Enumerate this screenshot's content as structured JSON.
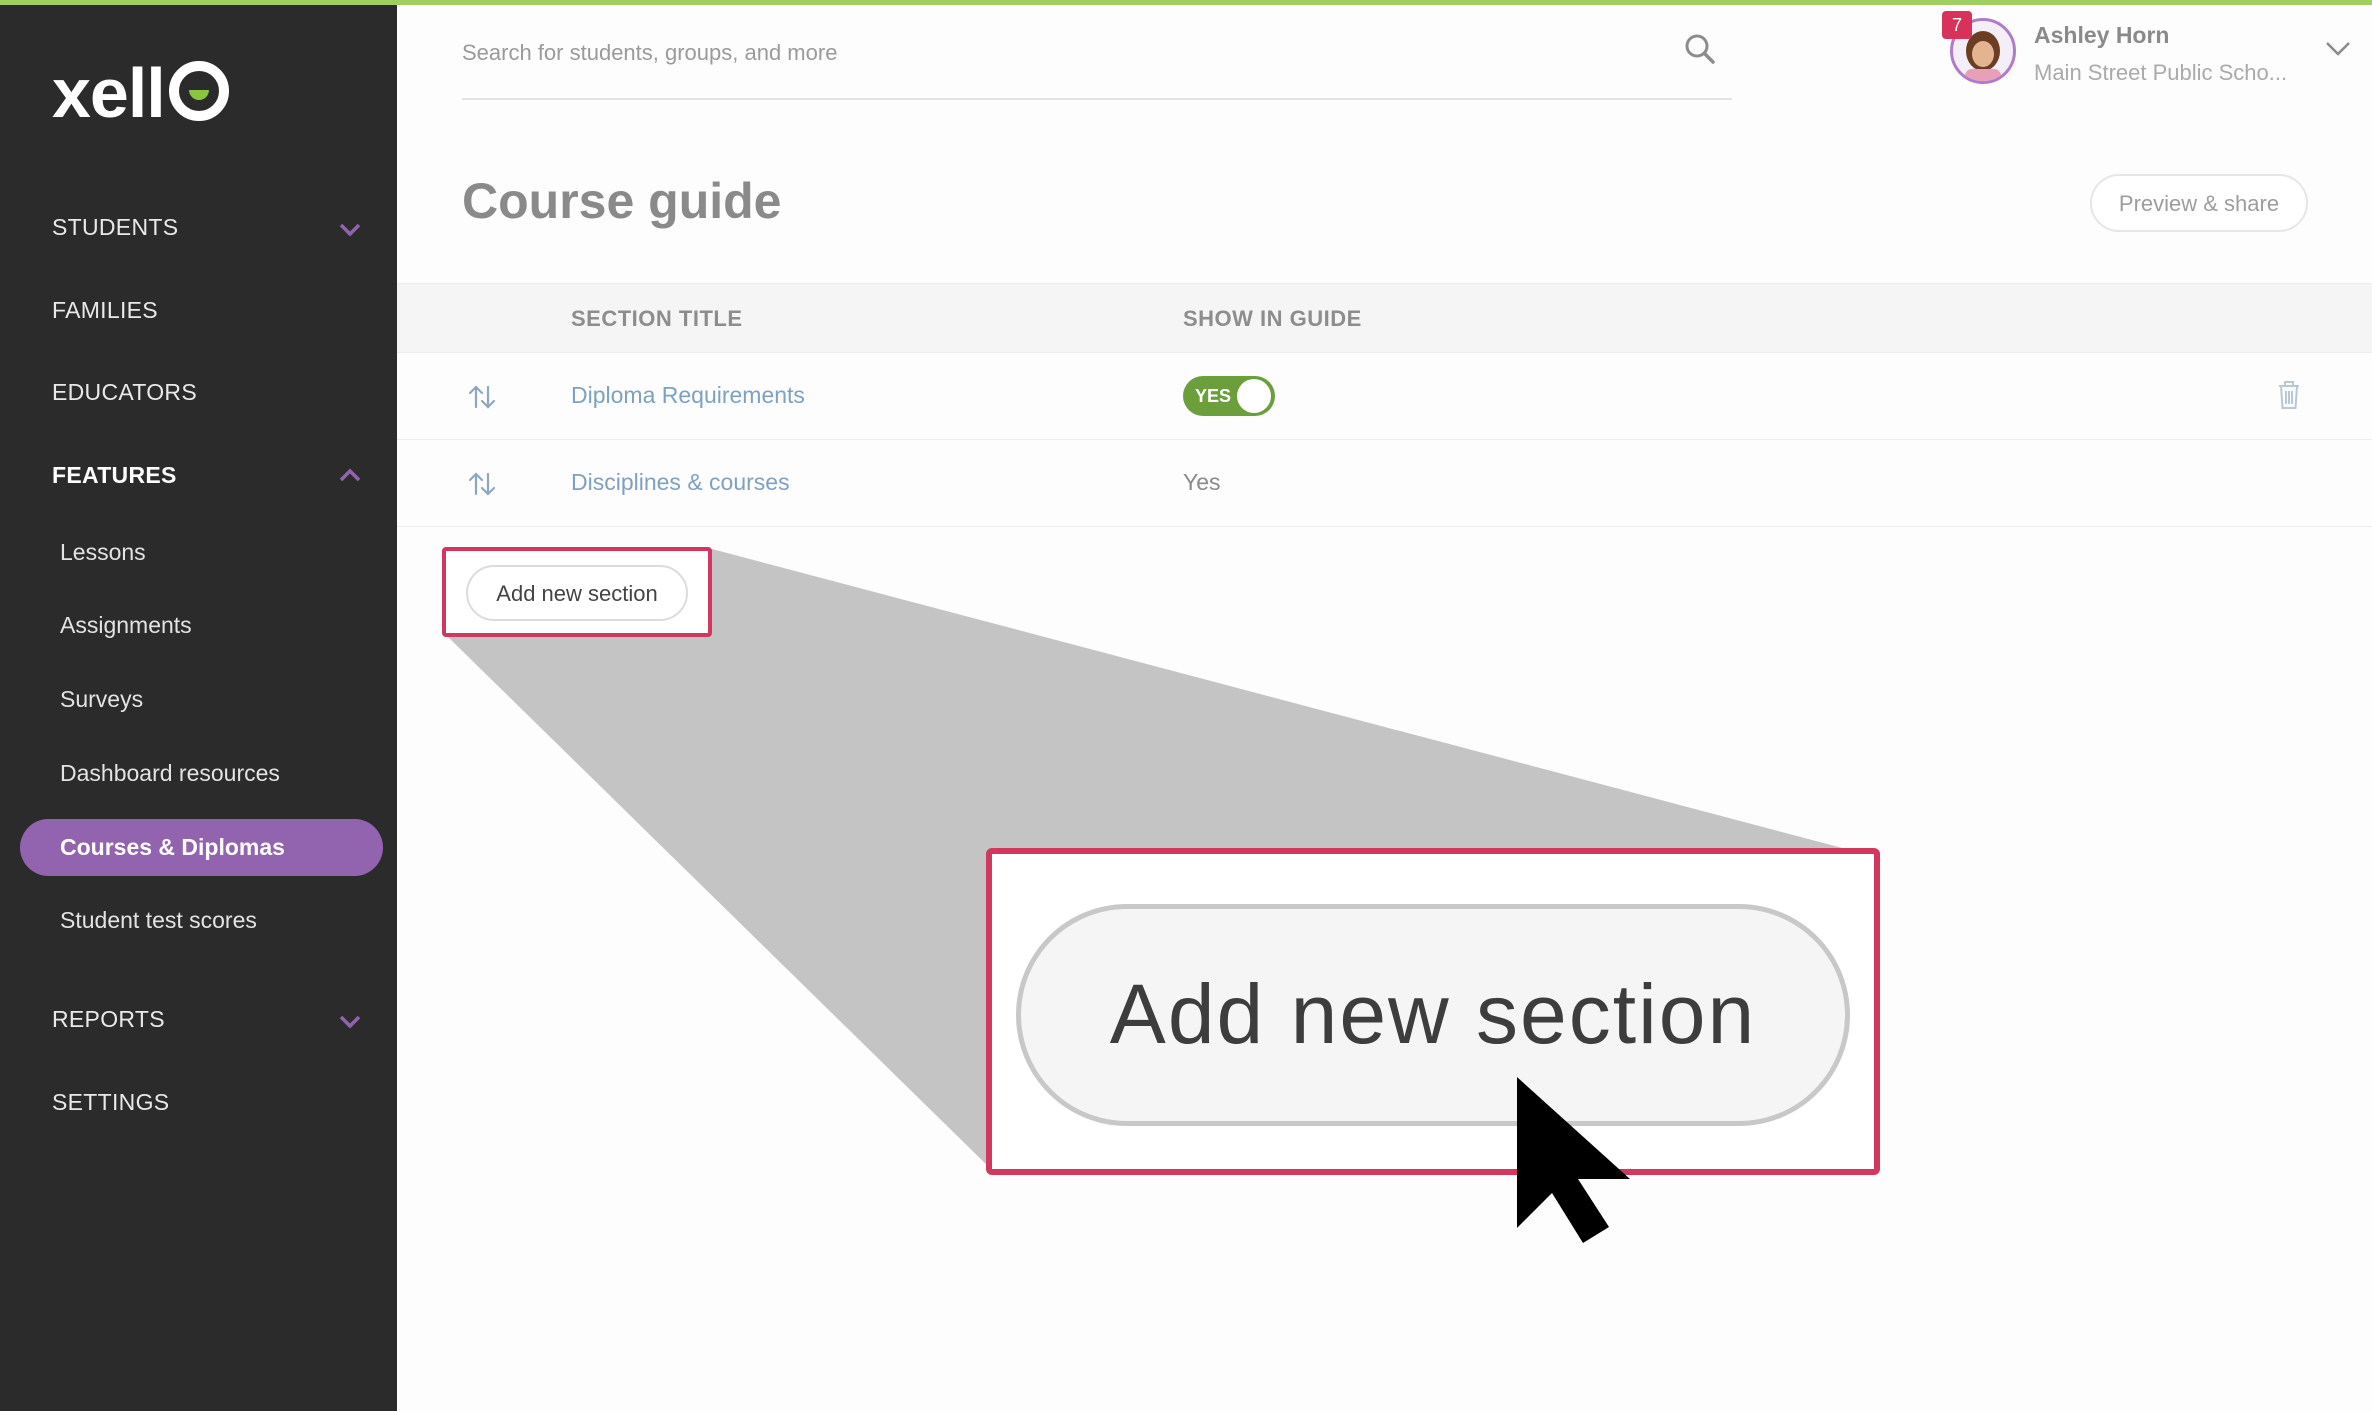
{
  "app": {
    "brand": "xello"
  },
  "sidebar": {
    "nav": [
      {
        "label": "STUDENTS",
        "expandable": true,
        "expanded": false
      },
      {
        "label": "FAMILIES"
      },
      {
        "label": "EDUCATORS"
      },
      {
        "label": "FEATURES",
        "expandable": true,
        "expanded": true,
        "active": true
      }
    ],
    "features_items": [
      {
        "label": "Lessons"
      },
      {
        "label": "Assignments"
      },
      {
        "label": "Surveys"
      },
      {
        "label": "Dashboard resources"
      },
      {
        "label": "Courses & Diplomas",
        "selected": true
      },
      {
        "label": "Student test scores"
      }
    ],
    "nav_bottom": [
      {
        "label": "REPORTS",
        "expandable": true,
        "expanded": false
      },
      {
        "label": "SETTINGS"
      }
    ]
  },
  "header": {
    "search_placeholder": "Search for students, groups, and more",
    "notification_count": "7",
    "user_name": "Ashley Horn",
    "user_school": "Main Street Public Scho..."
  },
  "page": {
    "title": "Course guide",
    "preview_button": "Preview & share"
  },
  "table": {
    "columns": [
      "SECTION TITLE",
      "SHOW IN GUIDE"
    ],
    "rows": [
      {
        "title": "Diploma Requirements",
        "show": "YES",
        "show_as": "toggle",
        "deletable": true
      },
      {
        "title": "Disciplines & courses",
        "show": "Yes",
        "show_as": "text",
        "deletable": false
      }
    ]
  },
  "add_section_button": "Add new section",
  "zoom_callout": {
    "label": "Add new section"
  },
  "colors": {
    "sidebar_bg": "#2b2b2c",
    "accent_purple": "#9264b0",
    "highlight_red": "#d2385f",
    "toggle_green": "#6b9f3b",
    "link_blue": "#7ea1c0",
    "top_line_green": "#9fcf5e"
  },
  "icons": [
    "chevron-down-icon",
    "chevron-up-icon",
    "search-icon",
    "sort-arrows-icon",
    "trash-icon",
    "mouse-cursor"
  ]
}
